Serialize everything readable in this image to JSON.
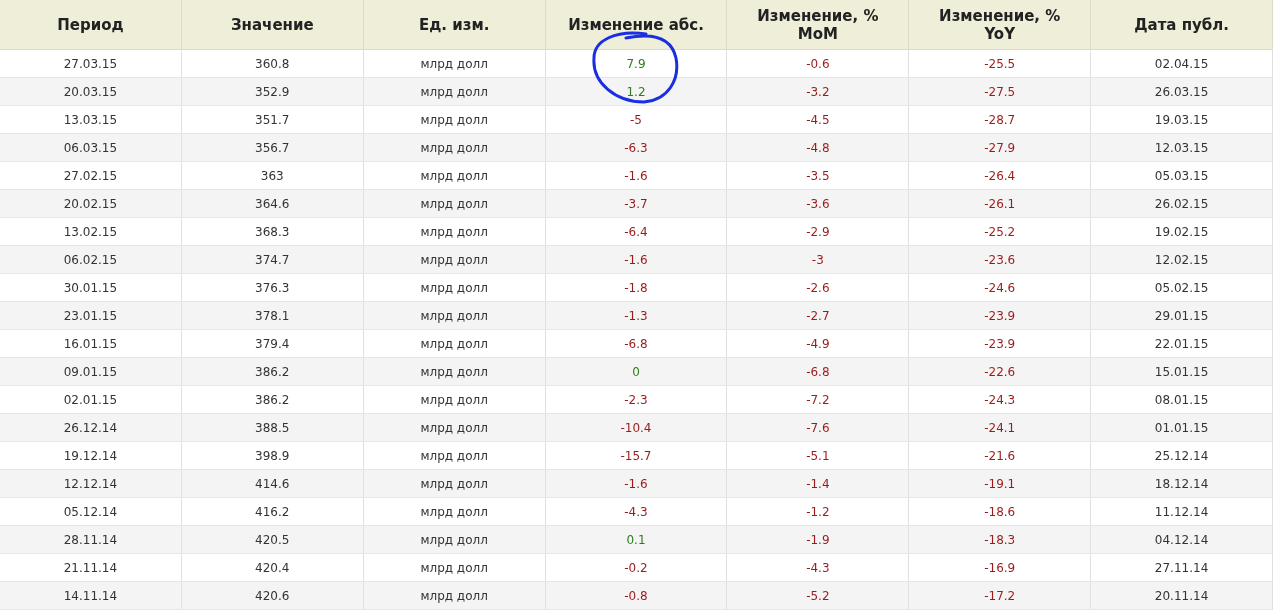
{
  "table": {
    "columns": [
      "Период",
      "Значение",
      "Ед. изм.",
      "Изменение абс.",
      "Изменение, %\nMoM",
      "Изменение, %\nYoY",
      "Дата публ."
    ],
    "rows": [
      {
        "period": "27.03.15",
        "value": "360.8",
        "unit": "млрд долл",
        "abs": {
          "text": "7.9",
          "color": "#2e7d1a"
        },
        "mom": {
          "text": "-0.6",
          "color": "#9b1b1b"
        },
        "yoy": {
          "text": "-25.5",
          "color": "#9b1b1b"
        },
        "date": "02.04.15"
      },
      {
        "period": "20.03.15",
        "value": "352.9",
        "unit": "млрд долл",
        "abs": {
          "text": "1.2",
          "color": "#2e7d1a"
        },
        "mom": {
          "text": "-3.2",
          "color": "#9b1b1b"
        },
        "yoy": {
          "text": "-27.5",
          "color": "#9b1b1b"
        },
        "date": "26.03.15"
      },
      {
        "period": "13.03.15",
        "value": "351.7",
        "unit": "млрд долл",
        "abs": {
          "text": "-5",
          "color": "#9b1b1b"
        },
        "mom": {
          "text": "-4.5",
          "color": "#9b1b1b"
        },
        "yoy": {
          "text": "-28.7",
          "color": "#9b1b1b"
        },
        "date": "19.03.15"
      },
      {
        "period": "06.03.15",
        "value": "356.7",
        "unit": "млрд долл",
        "abs": {
          "text": "-6.3",
          "color": "#9b1b1b"
        },
        "mom": {
          "text": "-4.8",
          "color": "#9b1b1b"
        },
        "yoy": {
          "text": "-27.9",
          "color": "#9b1b1b"
        },
        "date": "12.03.15"
      },
      {
        "period": "27.02.15",
        "value": "363",
        "unit": "млрд долл",
        "abs": {
          "text": "-1.6",
          "color": "#9b1b1b"
        },
        "mom": {
          "text": "-3.5",
          "color": "#9b1b1b"
        },
        "yoy": {
          "text": "-26.4",
          "color": "#9b1b1b"
        },
        "date": "05.03.15"
      },
      {
        "period": "20.02.15",
        "value": "364.6",
        "unit": "млрд долл",
        "abs": {
          "text": "-3.7",
          "color": "#9b1b1b"
        },
        "mom": {
          "text": "-3.6",
          "color": "#9b1b1b"
        },
        "yoy": {
          "text": "-26.1",
          "color": "#9b1b1b"
        },
        "date": "26.02.15"
      },
      {
        "period": "13.02.15",
        "value": "368.3",
        "unit": "млрд долл",
        "abs": {
          "text": "-6.4",
          "color": "#9b1b1b"
        },
        "mom": {
          "text": "-2.9",
          "color": "#9b1b1b"
        },
        "yoy": {
          "text": "-25.2",
          "color": "#9b1b1b"
        },
        "date": "19.02.15"
      },
      {
        "period": "06.02.15",
        "value": "374.7",
        "unit": "млрд долл",
        "abs": {
          "text": "-1.6",
          "color": "#9b1b1b"
        },
        "mom": {
          "text": "-3",
          "color": "#9b1b1b"
        },
        "yoy": {
          "text": "-23.6",
          "color": "#9b1b1b"
        },
        "date": "12.02.15"
      },
      {
        "period": "30.01.15",
        "value": "376.3",
        "unit": "млрд долл",
        "abs": {
          "text": "-1.8",
          "color": "#9b1b1b"
        },
        "mom": {
          "text": "-2.6",
          "color": "#9b1b1b"
        },
        "yoy": {
          "text": "-24.6",
          "color": "#9b1b1b"
        },
        "date": "05.02.15"
      },
      {
        "period": "23.01.15",
        "value": "378.1",
        "unit": "млрд долл",
        "abs": {
          "text": "-1.3",
          "color": "#9b1b1b"
        },
        "mom": {
          "text": "-2.7",
          "color": "#9b1b1b"
        },
        "yoy": {
          "text": "-23.9",
          "color": "#9b1b1b"
        },
        "date": "29.01.15"
      },
      {
        "period": "16.01.15",
        "value": "379.4",
        "unit": "млрд долл",
        "abs": {
          "text": "-6.8",
          "color": "#9b1b1b"
        },
        "mom": {
          "text": "-4.9",
          "color": "#9b1b1b"
        },
        "yoy": {
          "text": "-23.9",
          "color": "#9b1b1b"
        },
        "date": "22.01.15"
      },
      {
        "period": "09.01.15",
        "value": "386.2",
        "unit": "млрд долл",
        "abs": {
          "text": "0",
          "color": "#2e7d1a"
        },
        "mom": {
          "text": "-6.8",
          "color": "#9b1b1b"
        },
        "yoy": {
          "text": "-22.6",
          "color": "#9b1b1b"
        },
        "date": "15.01.15"
      },
      {
        "period": "02.01.15",
        "value": "386.2",
        "unit": "млрд долл",
        "abs": {
          "text": "-2.3",
          "color": "#9b1b1b"
        },
        "mom": {
          "text": "-7.2",
          "color": "#9b1b1b"
        },
        "yoy": {
          "text": "-24.3",
          "color": "#9b1b1b"
        },
        "date": "08.01.15"
      },
      {
        "period": "26.12.14",
        "value": "388.5",
        "unit": "млрд долл",
        "abs": {
          "text": "-10.4",
          "color": "#9b1b1b"
        },
        "mom": {
          "text": "-7.6",
          "color": "#9b1b1b"
        },
        "yoy": {
          "text": "-24.1",
          "color": "#9b1b1b"
        },
        "date": "01.01.15"
      },
      {
        "period": "19.12.14",
        "value": "398.9",
        "unit": "млрд долл",
        "abs": {
          "text": "-15.7",
          "color": "#9b1b1b"
        },
        "mom": {
          "text": "-5.1",
          "color": "#9b1b1b"
        },
        "yoy": {
          "text": "-21.6",
          "color": "#9b1b1b"
        },
        "date": "25.12.14"
      },
      {
        "period": "12.12.14",
        "value": "414.6",
        "unit": "млрд долл",
        "abs": {
          "text": "-1.6",
          "color": "#9b1b1b"
        },
        "mom": {
          "text": "-1.4",
          "color": "#9b1b1b"
        },
        "yoy": {
          "text": "-19.1",
          "color": "#9b1b1b"
        },
        "date": "18.12.14"
      },
      {
        "period": "05.12.14",
        "value": "416.2",
        "unit": "млрд долл",
        "abs": {
          "text": "-4.3",
          "color": "#9b1b1b"
        },
        "mom": {
          "text": "-1.2",
          "color": "#9b1b1b"
        },
        "yoy": {
          "text": "-18.6",
          "color": "#9b1b1b"
        },
        "date": "11.12.14"
      },
      {
        "period": "28.11.14",
        "value": "420.5",
        "unit": "млрд долл",
        "abs": {
          "text": "0.1",
          "color": "#2e7d1a"
        },
        "mom": {
          "text": "-1.9",
          "color": "#9b1b1b"
        },
        "yoy": {
          "text": "-18.3",
          "color": "#9b1b1b"
        },
        "date": "04.12.14"
      },
      {
        "period": "21.11.14",
        "value": "420.4",
        "unit": "млрд долл",
        "abs": {
          "text": "-0.2",
          "color": "#9b1b1b"
        },
        "mom": {
          "text": "-4.3",
          "color": "#9b1b1b"
        },
        "yoy": {
          "text": "-16.9",
          "color": "#9b1b1b"
        },
        "date": "27.11.14"
      },
      {
        "period": "14.11.14",
        "value": "420.6",
        "unit": "млрд долл",
        "abs": {
          "text": "-0.8",
          "color": "#9b1b1b"
        },
        "mom": {
          "text": "-5.2",
          "color": "#9b1b1b"
        },
        "yoy": {
          "text": "-17.2",
          "color": "#9b1b1b"
        },
        "date": "20.11.14"
      }
    ]
  }
}
